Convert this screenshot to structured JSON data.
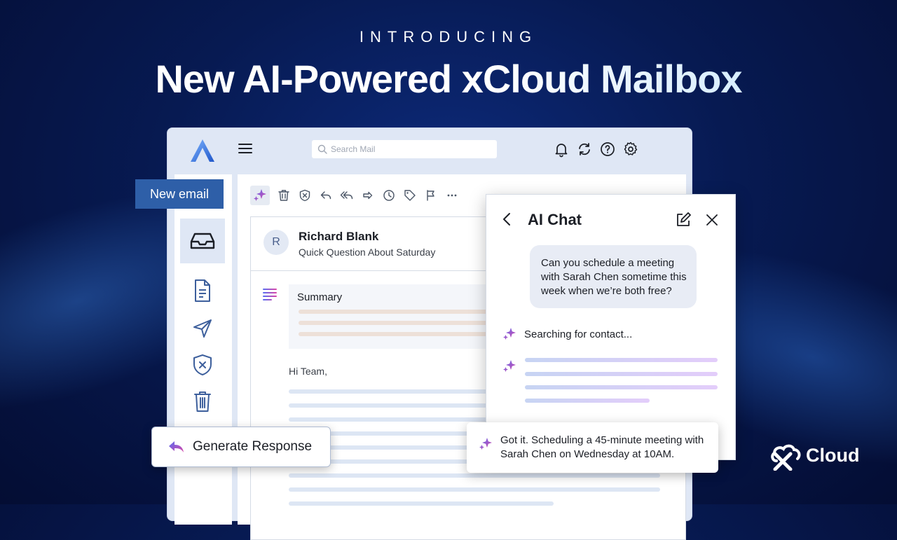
{
  "hero": {
    "eyebrow": "INTRODUCING",
    "title": "New AI-Powered xCloud Mailbox"
  },
  "header": {
    "search_placeholder": "Search Mail",
    "icons": [
      "bell-icon",
      "sync-icon",
      "help-icon",
      "settings-icon"
    ]
  },
  "sidebar": {
    "new_email_label": "New email",
    "items": [
      "inbox-icon",
      "document-icon",
      "send-icon",
      "shield-icon",
      "trash-icon"
    ]
  },
  "toolbar": {
    "icons": [
      "sparkle-icon",
      "trash-icon",
      "block-icon",
      "reply-icon",
      "reply-all-icon",
      "forward-icon",
      "clock-icon",
      "tag-icon",
      "flag-icon",
      "more-icon"
    ]
  },
  "email": {
    "avatar_initial": "R",
    "sender": "Richard Blank",
    "subject": "Quick Question About Saturday",
    "summary_label": "Summary",
    "greeting": "Hi Team,"
  },
  "actions": {
    "generate_response_label": "Generate Response"
  },
  "ai_chat": {
    "title": "AI Chat",
    "user_message": "Can you schedule a meeting with Sarah Chen sometime this week when we’re both free?",
    "status_message": "Searching for contact...",
    "ai_response": "Got it. Scheduling a 45-minute meeting with Sarah Chen on Wednesday at 10AM."
  },
  "brand": {
    "name": "Cloud"
  },
  "colors": {
    "background": "#071a52",
    "primary_button": "#2e5fa8",
    "app_frame": "#dfe7f5",
    "ai_accent_start": "#5b6cf0",
    "ai_accent_end": "#d946a8"
  }
}
